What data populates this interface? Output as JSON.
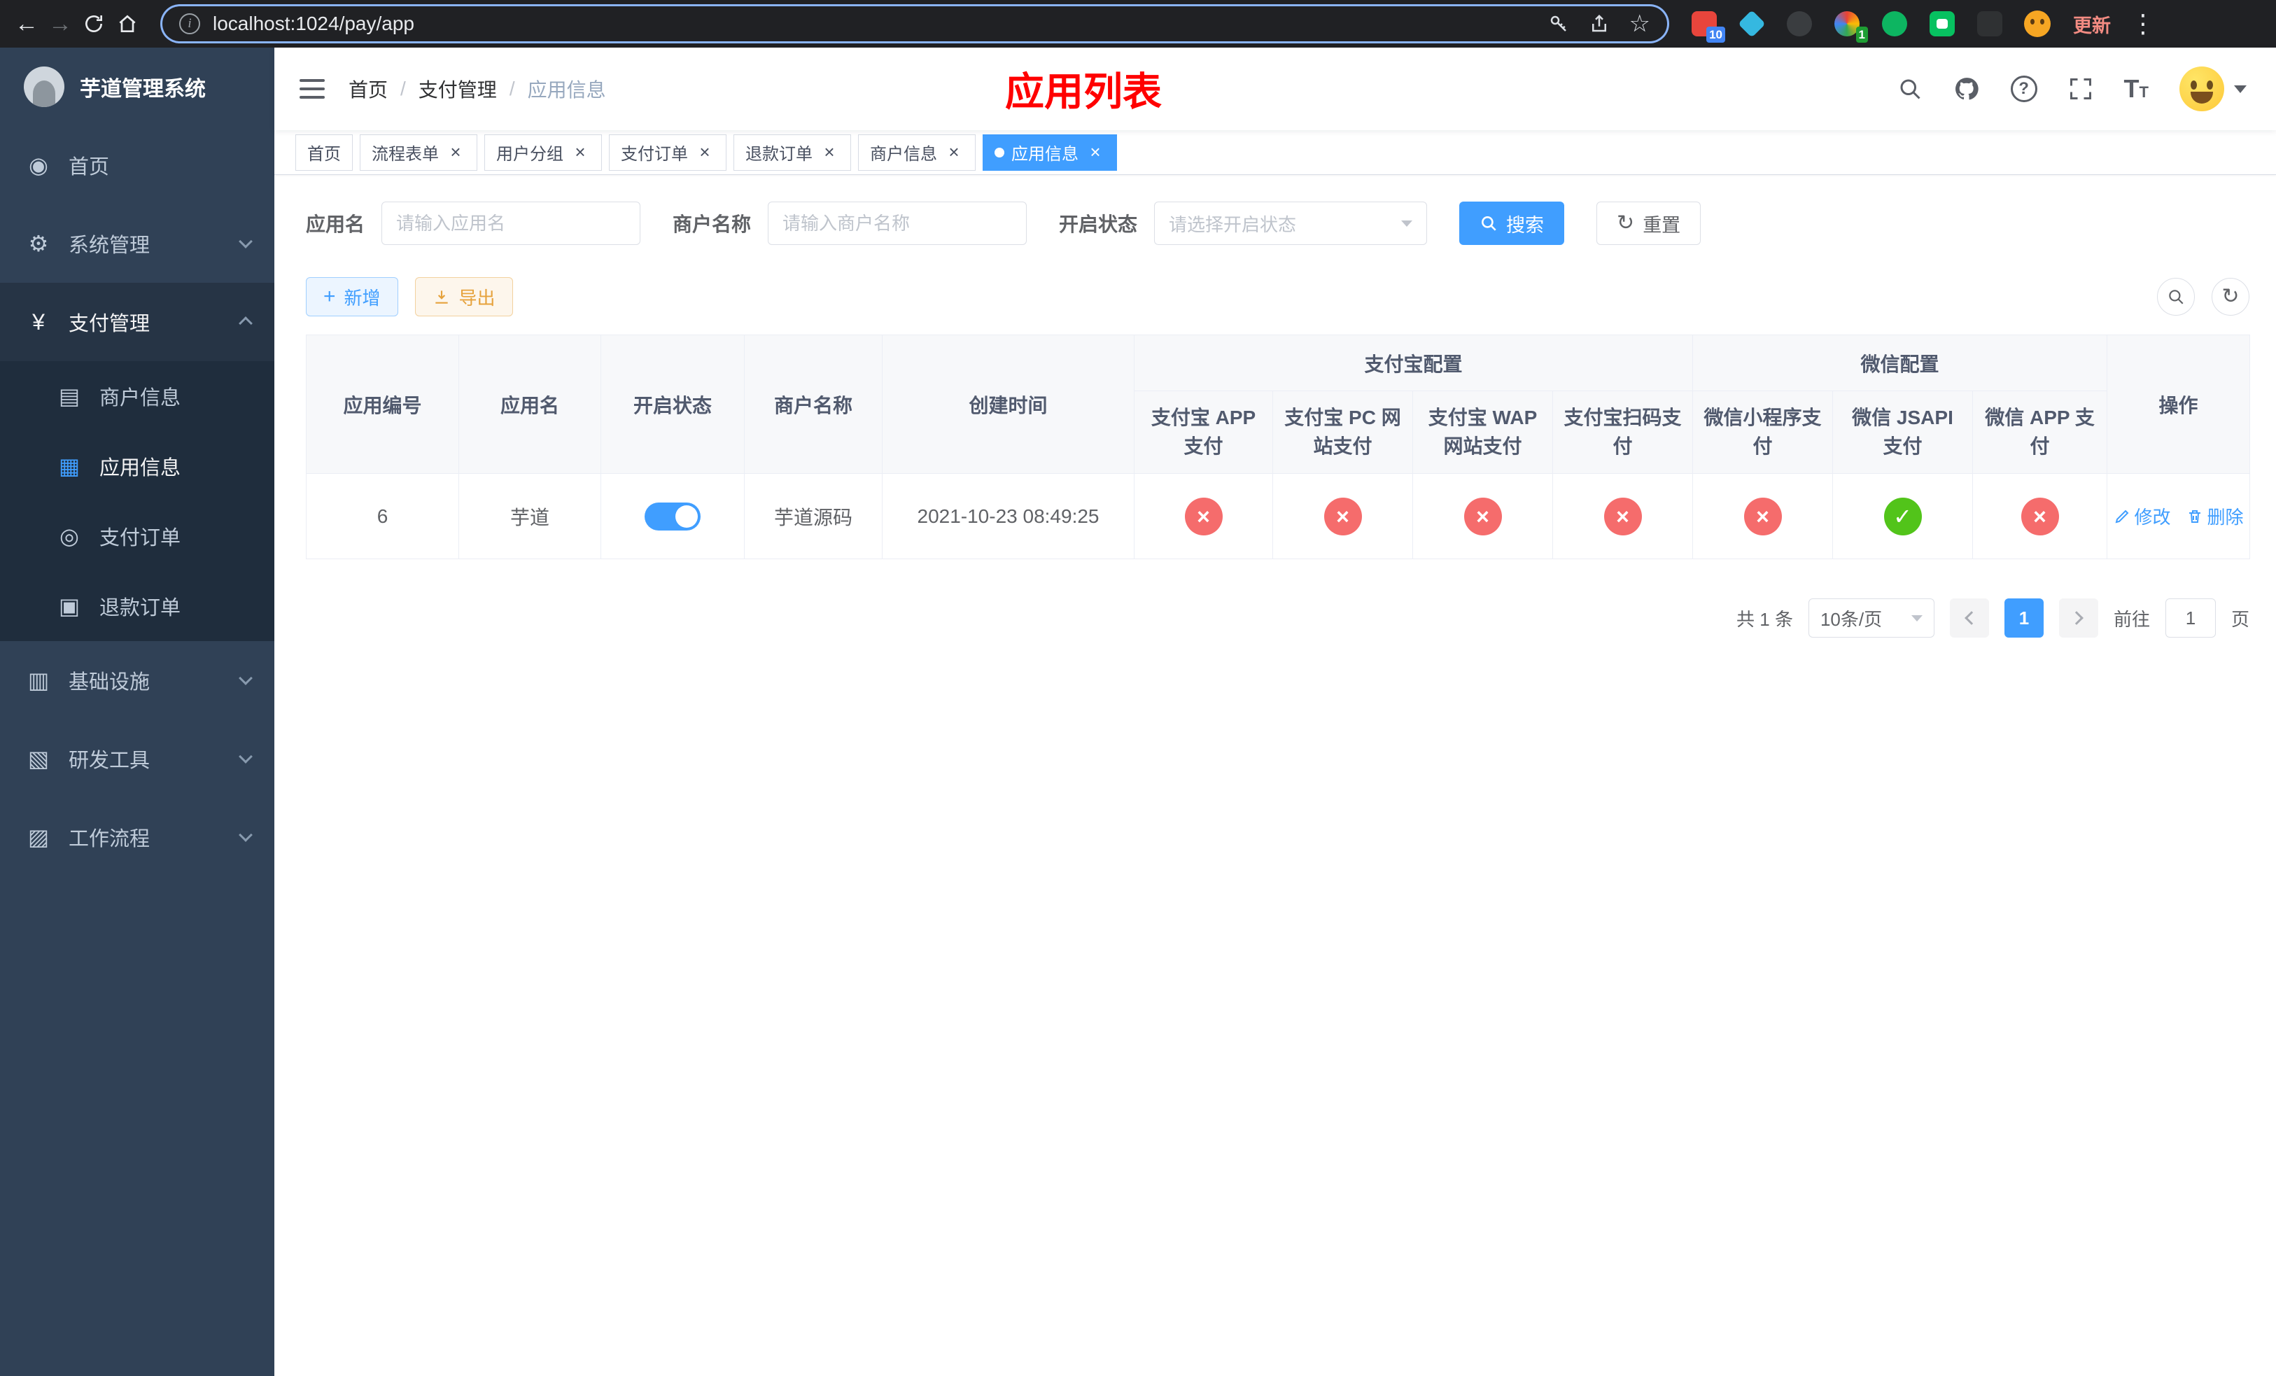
{
  "colors": {
    "accent": "#409eff",
    "danger": "#f56c6c",
    "success": "#52c41a",
    "warning": "#e6a23c",
    "overlay_red": "#ff0000"
  },
  "browser": {
    "url": "localhost:1024/pay/app",
    "update_label": "更新",
    "ext_badge_blue": "10",
    "ext_badge_green": "1"
  },
  "sidebar": {
    "title": "芋道管理系统",
    "items": {
      "home": "首页",
      "system": "系统管理",
      "payment": "支付管理",
      "merchant": "商户信息",
      "app": "应用信息",
      "pay_order": "支付订单",
      "refund_order": "退款订单",
      "infra": "基础设施",
      "devtools": "研发工具",
      "workflow": "工作流程"
    }
  },
  "header": {
    "breadcrumb": {
      "home": "首页",
      "section": "支付管理",
      "current": "应用信息"
    },
    "overlay_title": "应用列表"
  },
  "tabs": [
    {
      "label": "首页",
      "closable": false,
      "active": false
    },
    {
      "label": "流程表单",
      "closable": true,
      "active": false
    },
    {
      "label": "用户分组",
      "closable": true,
      "active": false
    },
    {
      "label": "支付订单",
      "closable": true,
      "active": false
    },
    {
      "label": "退款订单",
      "closable": true,
      "active": false
    },
    {
      "label": "商户信息",
      "closable": true,
      "active": false
    },
    {
      "label": "应用信息",
      "closable": true,
      "active": true
    }
  ],
  "filters": {
    "app_name_label": "应用名",
    "app_name_placeholder": "请输入应用名",
    "merchant_label": "商户名称",
    "merchant_placeholder": "请输入商户名称",
    "status_label": "开启状态",
    "status_placeholder": "请选择开启状态",
    "search_label": "搜索",
    "reset_label": "重置"
  },
  "toolbar": {
    "add_label": "新增",
    "export_label": "导出"
  },
  "table": {
    "group_headers": {
      "alipay": "支付宝配置",
      "wechat": "微信配置"
    },
    "columns": [
      "应用编号",
      "应用名",
      "开启状态",
      "商户名称",
      "创建时间",
      "支付宝 APP 支付",
      "支付宝 PC 网站支付",
      "支付宝 WAP 网站支付",
      "支付宝扫码支付",
      "微信小程序支付",
      "微信 JSAPI 支付",
      "微信 APP 支付",
      "操作"
    ],
    "yes_glyph": "✓",
    "no_glyph": "×",
    "rows": [
      {
        "id": "6",
        "name": "芋道",
        "enabled": true,
        "merchant": "芋道源码",
        "created_at": "2021-10-23 08:49:25",
        "statuses": [
          "no",
          "no",
          "no",
          "no",
          "no",
          "yes",
          "no"
        ],
        "edit_label": "修改",
        "delete_label": "删除"
      }
    ]
  },
  "pagination": {
    "total_text": "共 1 条",
    "page_size_label": "10条/页",
    "current_page": "1",
    "goto_prefix": "前往",
    "goto_value": "1",
    "goto_suffix": "页"
  }
}
